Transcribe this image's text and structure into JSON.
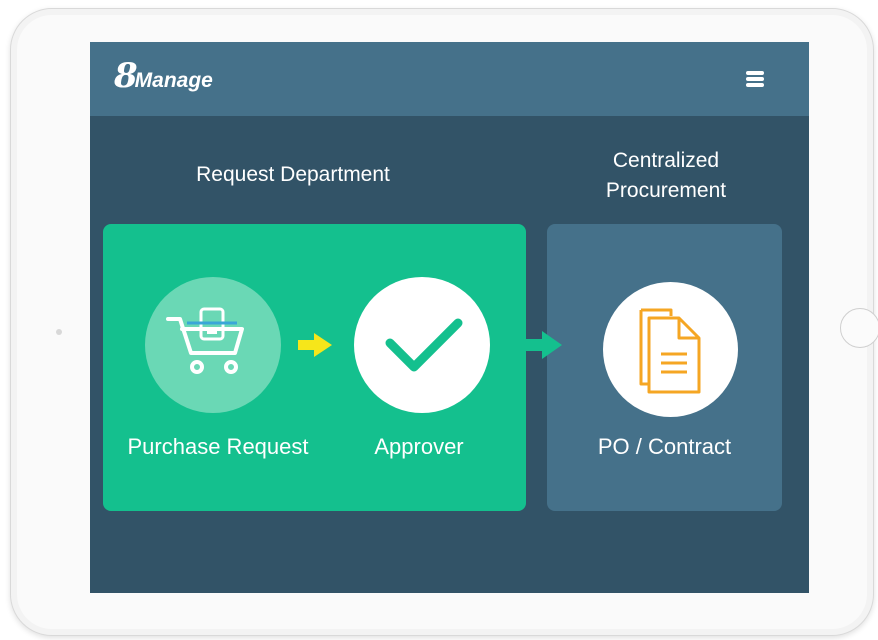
{
  "header": {
    "logo_number": "8",
    "logo_word": "Manage",
    "menu_icon": "hamburger-menu-icon"
  },
  "columns": {
    "request_department": "Request Department",
    "centralized_procurement_line1": "Centralized",
    "centralized_procurement_line2": "Procurement"
  },
  "steps": [
    {
      "label": "Purchase Request",
      "icon": "shopping-cart-icon"
    },
    {
      "label": "Approver",
      "icon": "checkmark-icon"
    },
    {
      "label": "PO / Contract",
      "icon": "document-icon"
    }
  ],
  "colors": {
    "screen_background": "#325367",
    "header_background": "#45718a",
    "request_box": "#14c08e",
    "procurement_box": "#45718a",
    "arrow_yellow": "#f6e61a",
    "arrow_green": "#14c08e",
    "document_orange": "#f5a623"
  }
}
